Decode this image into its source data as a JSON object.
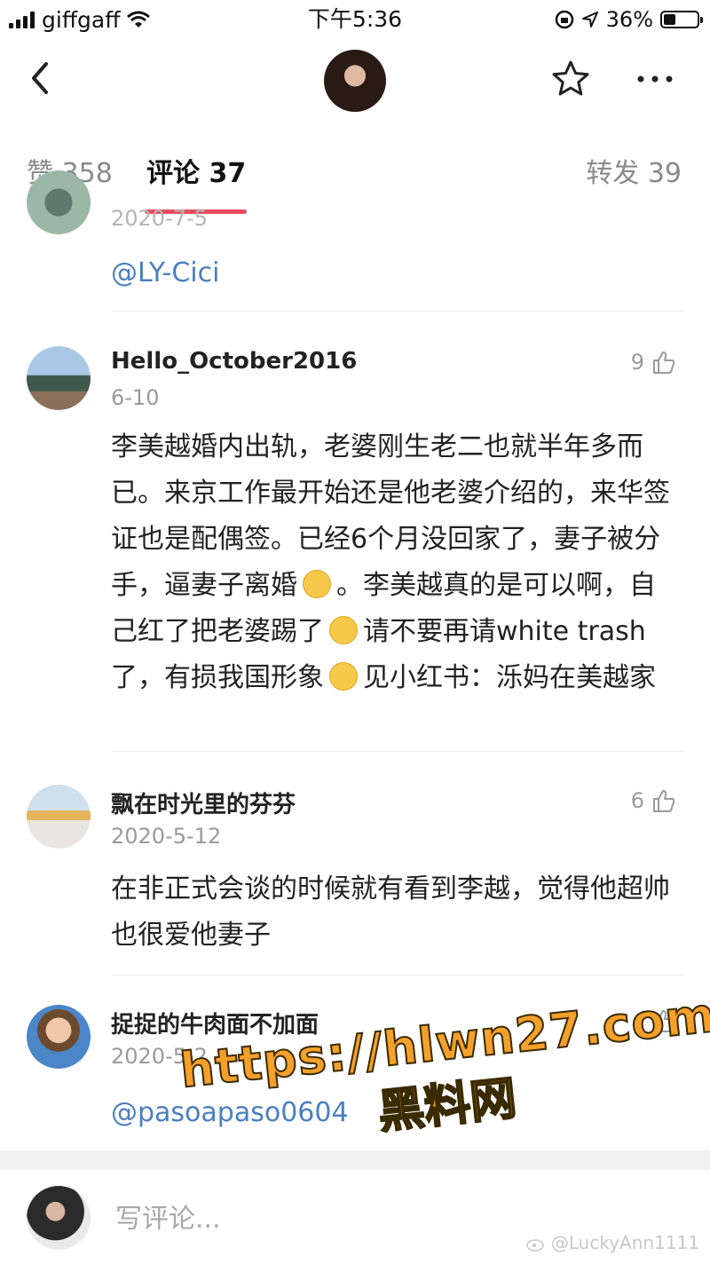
{
  "status_bar": {
    "carrier": "giffgaff",
    "time": "下午5:36",
    "battery": "36%"
  },
  "tabs": {
    "likes": "赞 358",
    "comments": "评论 37",
    "reposts": "转发 39"
  },
  "comments": [
    {
      "date": "2020-7-5",
      "text": "@LY-Cici"
    },
    {
      "name": "Hello_October2016",
      "date": "6-10",
      "likes": "9",
      "text_parts": [
        "李美越婚内出轨，老婆刚生老二也就半年多而已。来京工作最开始还是他老婆介绍的，来华签证也是配偶签。已经6个月没回家了，妻子被分手，逼妻子离婚",
        "。李美越真的是可以啊，自己红了把老婆踢了",
        "请不要再请white trash了，有损我国形象",
        "见小红书：泺妈在美越家"
      ]
    },
    {
      "name": "飘在时光里的芬芬",
      "date": "2020-5-12",
      "likes": "6",
      "text": "在非正式会谈的时候就有看到李越，觉得他超帅也很爱他妻子"
    },
    {
      "name": "捉捉的牛肉面不加面",
      "date": "2020-5-2",
      "likes": "",
      "text": "@pasoapaso0604"
    }
  ],
  "composer": {
    "placeholder": "写评论..."
  },
  "watermarks": {
    "url": "https://hlwn27.com",
    "site": "黑料网",
    "weibo": "@LuckyAnn1111"
  }
}
